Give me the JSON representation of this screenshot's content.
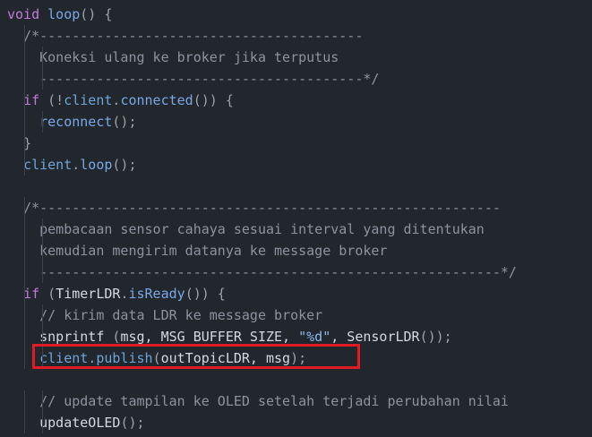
{
  "code": {
    "lines": [
      [
        {
          "t": "void ",
          "c": "kw"
        },
        {
          "t": "loop",
          "c": "fn"
        },
        {
          "t": "() {",
          "c": "punc"
        }
      ],
      [
        {
          "t": "  ",
          "c": "ident"
        },
        {
          "t": "/*----------------------------------------",
          "c": "cm"
        }
      ],
      [
        {
          "t": "    ",
          "c": "ident"
        },
        {
          "t": "Koneksi ulang ke broker jika terputus",
          "c": "cm"
        }
      ],
      [
        {
          "t": "    ",
          "c": "ident"
        },
        {
          "t": "----------------------------------------*/",
          "c": "cm"
        }
      ],
      [
        {
          "t": "  ",
          "c": "ident"
        },
        {
          "t": "if ",
          "c": "kw"
        },
        {
          "t": "(!",
          "c": "punc"
        },
        {
          "t": "client",
          "c": "obj"
        },
        {
          "t": ".",
          "c": "punc"
        },
        {
          "t": "connected",
          "c": "fn"
        },
        {
          "t": "()) {",
          "c": "punc"
        }
      ],
      [
        {
          "t": "    ",
          "c": "ident"
        },
        {
          "t": "reconnect",
          "c": "fn"
        },
        {
          "t": "();",
          "c": "punc"
        }
      ],
      [
        {
          "t": "  ",
          "c": "ident"
        },
        {
          "t": "}",
          "c": "punc"
        }
      ],
      [
        {
          "t": "  ",
          "c": "ident"
        },
        {
          "t": "client",
          "c": "obj"
        },
        {
          "t": ".",
          "c": "punc"
        },
        {
          "t": "loop",
          "c": "fn"
        },
        {
          "t": "();",
          "c": "punc"
        }
      ],
      [],
      [
        {
          "t": "  ",
          "c": "ident"
        },
        {
          "t": "/*---------------------------------------------------------",
          "c": "cm"
        }
      ],
      [
        {
          "t": "    ",
          "c": "ident"
        },
        {
          "t": "pembacaan sensor cahaya sesuai interval yang ditentukan",
          "c": "cm"
        }
      ],
      [
        {
          "t": "    ",
          "c": "ident"
        },
        {
          "t": "kemudian mengirim datanya ke message broker",
          "c": "cm"
        }
      ],
      [
        {
          "t": "    ",
          "c": "ident"
        },
        {
          "t": "---------------------------------------------------------*/",
          "c": "cm"
        }
      ],
      [
        {
          "t": "  ",
          "c": "ident"
        },
        {
          "t": "if ",
          "c": "kw"
        },
        {
          "t": "(",
          "c": "punc"
        },
        {
          "t": "TimerLDR",
          "c": "ident"
        },
        {
          "t": ".",
          "c": "punc"
        },
        {
          "t": "isReady",
          "c": "fn"
        },
        {
          "t": "()) {",
          "c": "punc"
        }
      ],
      [
        {
          "t": "    ",
          "c": "ident"
        },
        {
          "t": "// kirim data LDR ke message broker",
          "c": "cm"
        }
      ],
      [
        {
          "t": "    ",
          "c": "ident"
        },
        {
          "t": "snprintf",
          "c": "ident"
        },
        {
          "t": " (",
          "c": "punc"
        },
        {
          "t": "msg, MSG_BUFFER_SIZE, ",
          "c": "ident"
        },
        {
          "t": "\"%d\"",
          "c": "str"
        },
        {
          "t": ", SensorLDR",
          "c": "ident"
        },
        {
          "t": "());",
          "c": "punc"
        }
      ],
      [
        {
          "t": "    ",
          "c": "ident"
        },
        {
          "t": "client",
          "c": "obj"
        },
        {
          "t": ".",
          "c": "punc"
        },
        {
          "t": "publish",
          "c": "obj"
        },
        {
          "t": "(",
          "c": "punc"
        },
        {
          "t": "outTopicLDR, msg",
          "c": "ident"
        },
        {
          "t": ");",
          "c": "punc"
        }
      ],
      [],
      [
        {
          "t": "    ",
          "c": "ident"
        },
        {
          "t": "// update tampilan ke OLED setelah terjadi perubahan nilai",
          "c": "cm"
        }
      ],
      [
        {
          "t": "    ",
          "c": "ident"
        },
        {
          "t": "updateOLED",
          "c": "ident"
        },
        {
          "t": "();",
          "c": "punc"
        }
      ]
    ]
  },
  "highlight": {
    "line_number": 17,
    "color": "#e01b24"
  }
}
